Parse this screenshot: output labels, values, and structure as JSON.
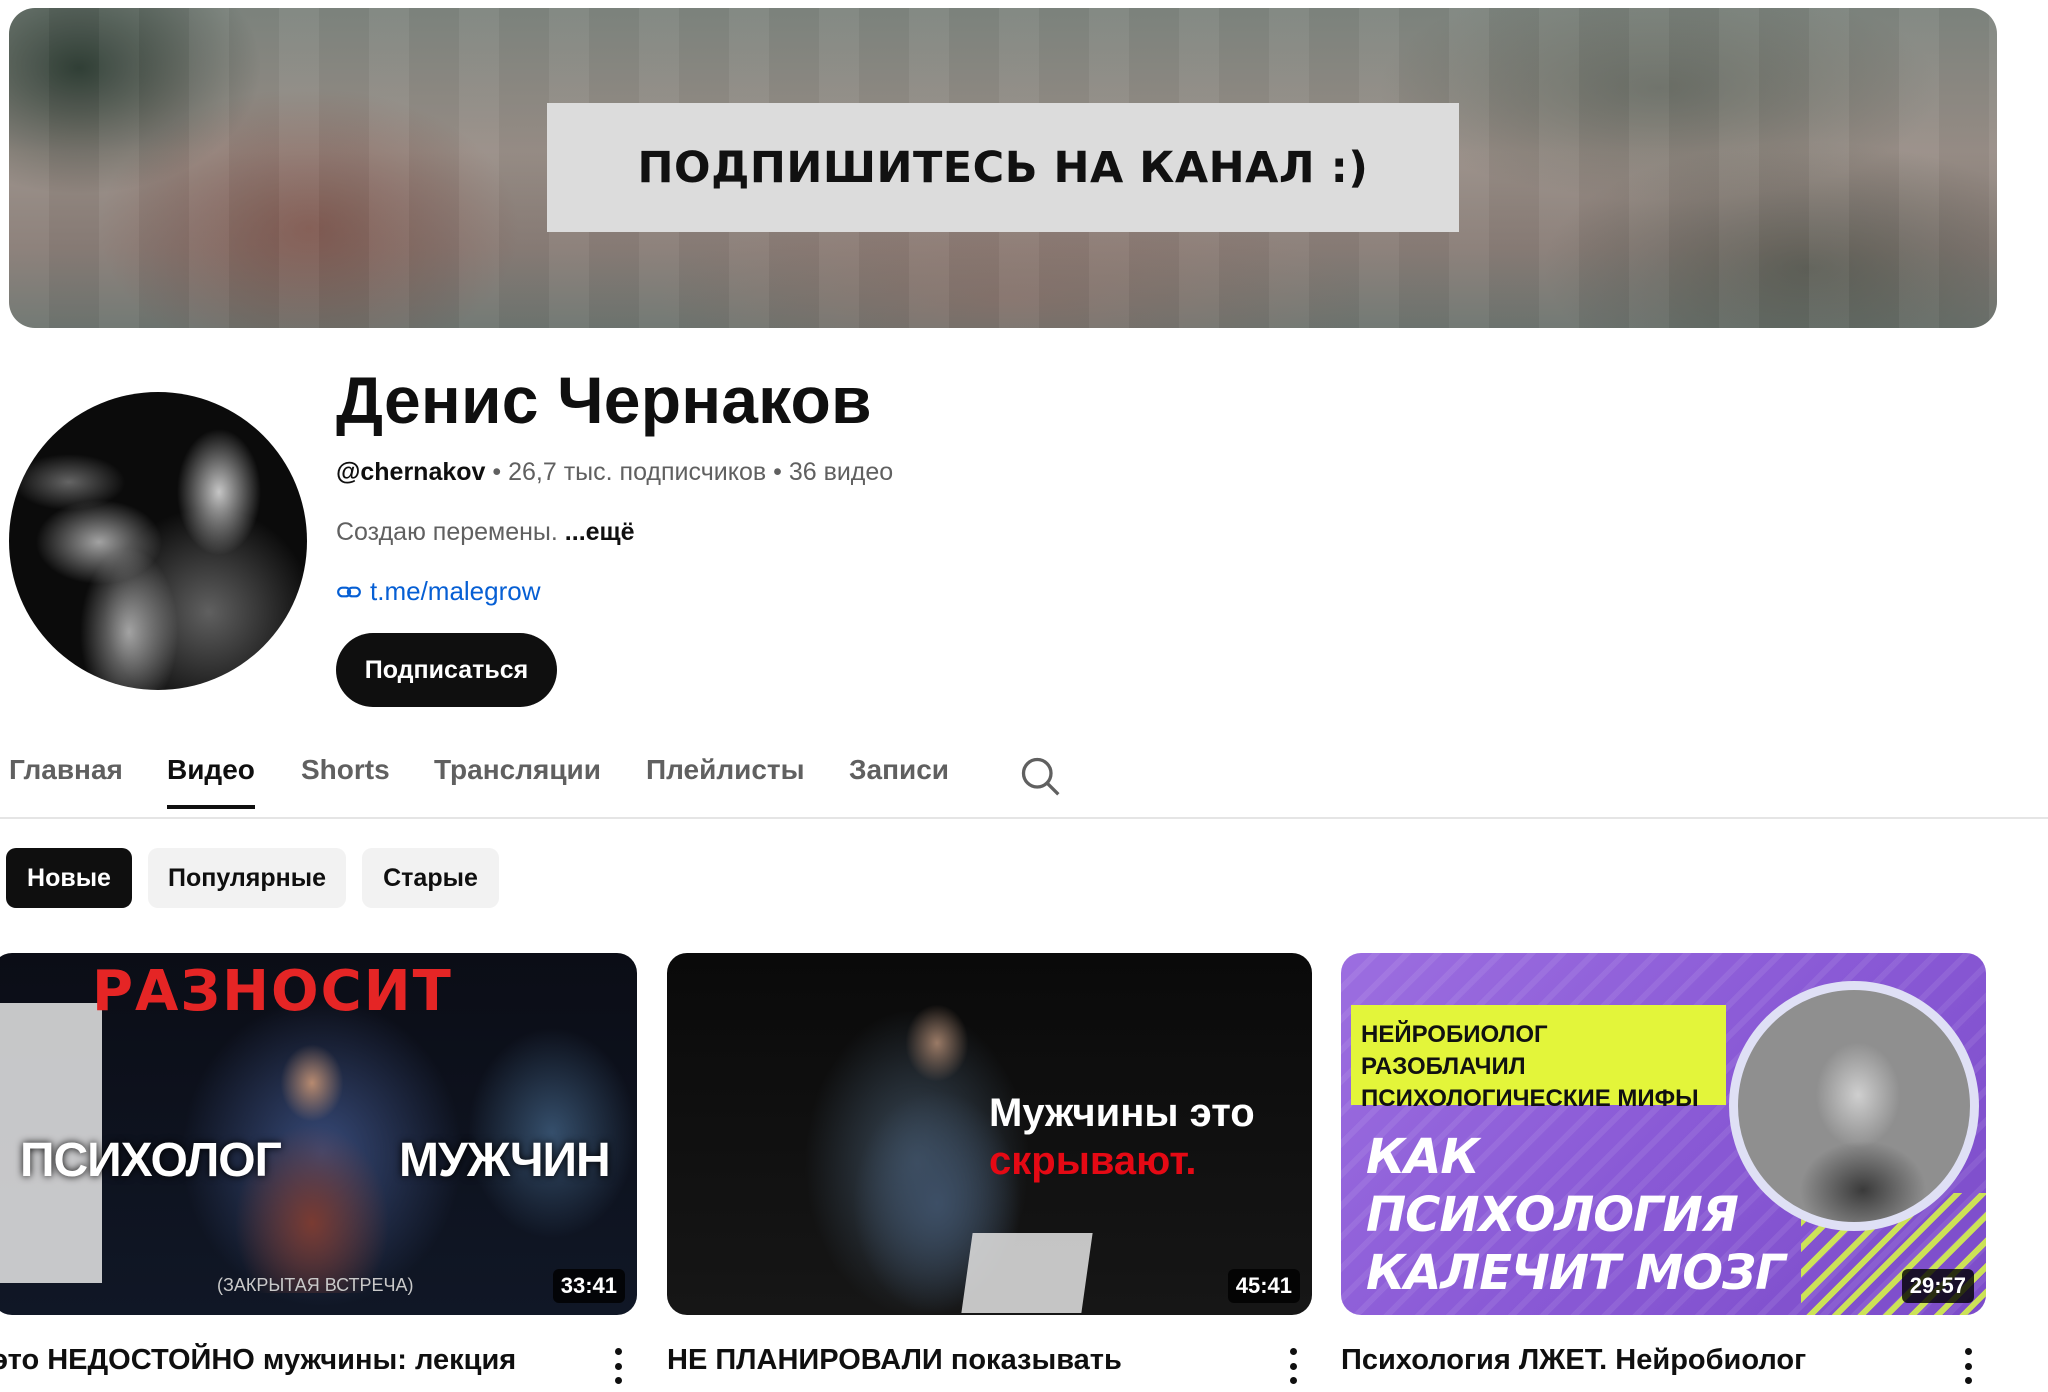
{
  "banner": {
    "text": "ПОДПИШИТЕСЬ НА КАНАЛ :)"
  },
  "channel": {
    "name": "Денис Чернаков",
    "handle": "@chernakov",
    "subscribers": "26,7 тыс. подписчиков",
    "videos": "36 видео",
    "separator": "•",
    "description": "Создаю перемены.",
    "more": "...ещё",
    "link": "t.me/malegrow",
    "subscribe_label": "Подписаться"
  },
  "tabs": [
    {
      "label": "Главная",
      "active": false
    },
    {
      "label": "Видео",
      "active": true
    },
    {
      "label": "Shorts",
      "active": false
    },
    {
      "label": "Трансляции",
      "active": false
    },
    {
      "label": "Плейлисты",
      "active": false
    },
    {
      "label": "Записи",
      "active": false
    }
  ],
  "chips": [
    {
      "label": "Новые",
      "active": true
    },
    {
      "label": "Популярные",
      "active": false
    },
    {
      "label": "Старые",
      "active": false
    }
  ],
  "videos": [
    {
      "title": "это НЕДОСТОЙНО мужчины: лекция",
      "duration": "33:41",
      "thumb_text": {
        "top": "РАЗНОСИТ",
        "left": "ПСИХОЛОГ",
        "right": "МУЖЧИН",
        "bottom": "(ЗАКРЫТАЯ ВСТРЕЧА)"
      }
    },
    {
      "title": "НЕ ПЛАНИРОВАЛИ показывать",
      "duration": "45:41",
      "thumb_text": {
        "line1": "Мужчины это",
        "line2": "скрывают."
      }
    },
    {
      "title": "Психология ЛЖЕТ. Нейробиолог",
      "duration": "29:57",
      "thumb_text": {
        "tag1": "НЕЙРОБИОЛОГ РАЗОБЛАЧИЛ",
        "tag2": "ПСИХОЛОГИЧЕСКИЕ МИФЫ",
        "big1": "КАК",
        "big2": "ПСИХОЛОГИЯ",
        "big3": "КАЛЕЧИТ МОЗГ"
      }
    }
  ],
  "icons": {
    "link": "link-icon",
    "search": "search-icon",
    "more": "more-vert-icon"
  },
  "colors": {
    "link": "#065fd4",
    "accent_red": "#e52525",
    "chip_active": "#0f0f0f"
  }
}
